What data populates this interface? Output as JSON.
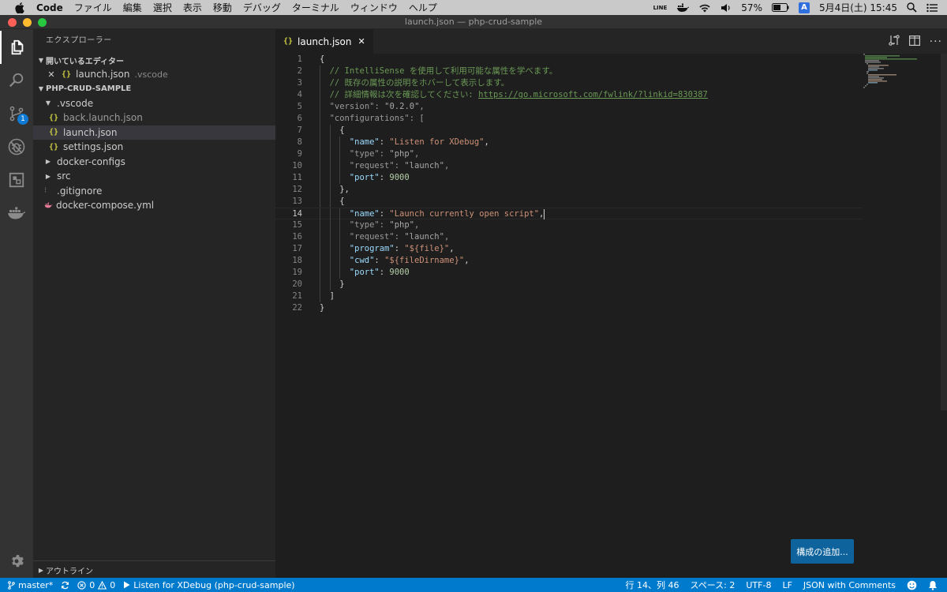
{
  "menubar": {
    "app_name": "Code",
    "menus": [
      "ファイル",
      "編集",
      "選択",
      "表示",
      "移動",
      "デバッグ",
      "ターミナル",
      "ウィンドウ",
      "ヘルプ"
    ],
    "line_label": "LINE",
    "battery": "57%",
    "ime": "A",
    "clock": "5月4日(土)  15:45"
  },
  "window": {
    "title": "launch.json — php-crud-sample"
  },
  "activity": {
    "scm_badge": "1"
  },
  "sidebar": {
    "header": "エクスプローラー",
    "open_editors": {
      "title": "開いているエディター",
      "items": [
        {
          "name": "launch.json",
          "desc": ".vscode"
        }
      ]
    },
    "project": {
      "title": "PHP-CRUD-SAMPLE",
      "items": [
        {
          "label": ".vscode"
        },
        {
          "label": "back.launch.json"
        },
        {
          "label": "launch.json"
        },
        {
          "label": "settings.json"
        },
        {
          "label": "docker-configs"
        },
        {
          "label": "src"
        },
        {
          "label": ".gitignore"
        },
        {
          "label": "docker-compose.yml"
        }
      ]
    },
    "outline": "アウトライン"
  },
  "editor": {
    "tab_label": "launch.json",
    "current_line": 14,
    "lines": [
      {
        "n": "1",
        "t": [
          [
            "p",
            "{"
          ]
        ]
      },
      {
        "n": "2",
        "t": [
          [
            "c",
            "// IntelliSense を使用して利用可能な属性を学べます。"
          ]
        ]
      },
      {
        "n": "3",
        "t": [
          [
            "c",
            "// 既存の属性の説明をホバーして表示します。"
          ]
        ]
      },
      {
        "n": "4",
        "t": [
          [
            "c",
            "// 詳細情報は次を確認してください: "
          ],
          [
            "l",
            "https://go.microsoft.com/fwlink/?linkid=830387"
          ]
        ]
      },
      {
        "n": "5",
        "t": [
          [
            "kd",
            "\"version\""
          ],
          [
            "pd",
            ": "
          ],
          [
            "sd",
            "\"0.2.0\""
          ],
          [
            "pd",
            ","
          ]
        ]
      },
      {
        "n": "6",
        "t": [
          [
            "kd",
            "\"configurations\""
          ],
          [
            "pd",
            ": ["
          ]
        ]
      },
      {
        "n": "7",
        "t": [
          [
            "p",
            "{"
          ]
        ]
      },
      {
        "n": "8",
        "t": [
          [
            "k",
            "\"name\""
          ],
          [
            "p",
            ": "
          ],
          [
            "s",
            "\"Listen for XDebug\""
          ],
          [
            "p",
            ","
          ]
        ]
      },
      {
        "n": "9",
        "t": [
          [
            "kd",
            "\"type\""
          ],
          [
            "pd",
            ": "
          ],
          [
            "sd",
            "\"php\""
          ],
          [
            "pd",
            ","
          ]
        ]
      },
      {
        "n": "10",
        "t": [
          [
            "kd",
            "\"request\""
          ],
          [
            "pd",
            ": "
          ],
          [
            "sd",
            "\"launch\""
          ],
          [
            "pd",
            ","
          ]
        ]
      },
      {
        "n": "11",
        "t": [
          [
            "k",
            "\"port\""
          ],
          [
            "p",
            ": "
          ],
          [
            "n",
            "9000"
          ]
        ]
      },
      {
        "n": "12",
        "t": [
          [
            "p",
            "},"
          ]
        ]
      },
      {
        "n": "13",
        "t": [
          [
            "p",
            "{"
          ]
        ]
      },
      {
        "n": "14",
        "t": [
          [
            "k",
            "\"name\""
          ],
          [
            "p",
            ": "
          ],
          [
            "s",
            "\"Launch currently open script\""
          ],
          [
            "p",
            ","
          ]
        ]
      },
      {
        "n": "15",
        "t": [
          [
            "kd",
            "\"type\""
          ],
          [
            "pd",
            ": "
          ],
          [
            "sd",
            "\"php\""
          ],
          [
            "pd",
            ","
          ]
        ]
      },
      {
        "n": "16",
        "t": [
          [
            "kd",
            "\"request\""
          ],
          [
            "pd",
            ": "
          ],
          [
            "sd",
            "\"launch\""
          ],
          [
            "pd",
            ","
          ]
        ]
      },
      {
        "n": "17",
        "t": [
          [
            "k",
            "\"program\""
          ],
          [
            "p",
            ": "
          ],
          [
            "s",
            "\"${file}\""
          ],
          [
            "p",
            ","
          ]
        ]
      },
      {
        "n": "18",
        "t": [
          [
            "k",
            "\"cwd\""
          ],
          [
            "p",
            ": "
          ],
          [
            "s",
            "\"${fileDirname}\""
          ],
          [
            "p",
            ","
          ]
        ]
      },
      {
        "n": "19",
        "t": [
          [
            "k",
            "\"port\""
          ],
          [
            "p",
            ": "
          ],
          [
            "n",
            "9000"
          ]
        ]
      },
      {
        "n": "20",
        "t": [
          [
            "p",
            "}"
          ]
        ]
      },
      {
        "n": "21",
        "t": [
          [
            "p",
            "]"
          ]
        ]
      },
      {
        "n": "22",
        "t": [
          [
            "p",
            "}"
          ]
        ]
      }
    ],
    "add_config_button": "構成の追加..."
  },
  "statusbar": {
    "branch": "master*",
    "errors": "0",
    "warnings": "0",
    "debug_config": "Listen for XDebug (php-crud-sample)",
    "cursor_pos": "行 14、列 46",
    "indent": "スペース: 2",
    "encoding": "UTF-8",
    "eol": "LF",
    "language": "JSON with Comments"
  },
  "colors": {
    "accent": "#007acc",
    "button": "#0e639c",
    "comment": "#6a9955",
    "string": "#ce9178",
    "key": "#9cdcfe",
    "number": "#b5cea8"
  }
}
